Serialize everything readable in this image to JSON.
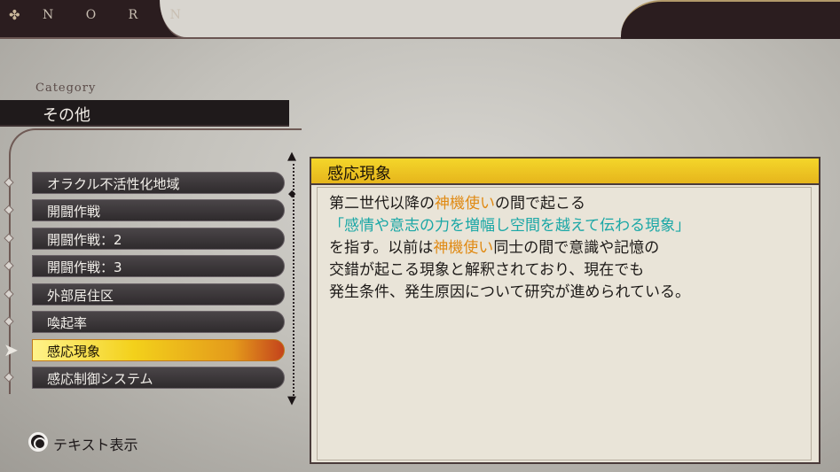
{
  "header": {
    "logo_icon": "flower-emblem",
    "brand": "N O R N"
  },
  "category": {
    "label": "Category",
    "value": "その他"
  },
  "list": {
    "items": [
      {
        "label": "オラクル不活性化地域",
        "selected": false
      },
      {
        "label": "開闘作戦",
        "selected": false
      },
      {
        "label": "開闘作戦：2",
        "selected": false
      },
      {
        "label": "開闘作戦：3",
        "selected": false
      },
      {
        "label": "外部居住区",
        "selected": false
      },
      {
        "label": "喚起率",
        "selected": false
      },
      {
        "label": "感応現象",
        "selected": true
      },
      {
        "label": "感応制御システム",
        "selected": false
      }
    ]
  },
  "panel": {
    "title": "感応現象",
    "line1_a": "第二世代以降の",
    "line1_b": "神機使い",
    "line1_c": "の間で起こる",
    "line2": "「感情や意志の力を増幅し空間を越えて伝わる現象」",
    "line3_a": "を指す。以前は",
    "line3_b": "神機使い",
    "line3_c": "同士の間で意識や記憶の",
    "line4": "交錯が起こる現象と解釈されており、現在でも",
    "line5": "発生条件、発生原因について研究が進められている。"
  },
  "hint": {
    "button_icon": "circle-button-icon",
    "label": "テキスト表示"
  },
  "colors": {
    "accent_yellow": "#f4d62a",
    "keyword_orange": "#e08a14",
    "quote_teal": "#1aa7a6"
  }
}
